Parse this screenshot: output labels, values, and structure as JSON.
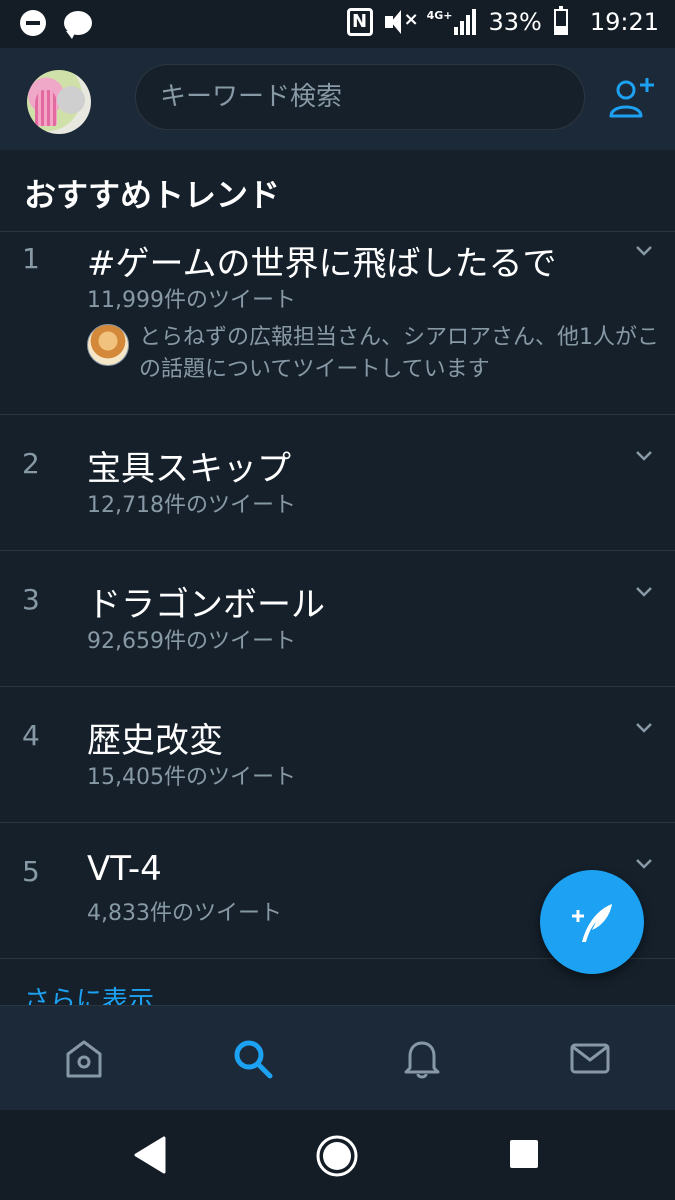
{
  "status_bar": {
    "battery": "33%",
    "time": "19:21",
    "network": "4G+",
    "icons": [
      "do-not-disturb-icon",
      "message-icon",
      "nfc-icon",
      "mute-icon",
      "signal-icon",
      "battery-icon"
    ],
    "nfc_glyph": "N"
  },
  "header": {
    "search_placeholder": "キーワード検索",
    "icons": [
      "avatar",
      "add-user-icon"
    ]
  },
  "section": {
    "title": "おすすめトレンド"
  },
  "trends": [
    {
      "rank": "1",
      "name": "#ゲームの世界に飛ばしたるで",
      "count": "11,999件のツイート",
      "context": "とらねずの広報担当さん、シアロアさん、他1人がこの話題についてツイートしています"
    },
    {
      "rank": "2",
      "name": "宝具スキップ",
      "count": "12,718件のツイート"
    },
    {
      "rank": "3",
      "name": "ドラゴンボール",
      "count": "92,659件のツイート"
    },
    {
      "rank": "4",
      "name": "歴史改変",
      "count": "15,405件のツイート"
    },
    {
      "rank": "5",
      "name": "VT-4",
      "count": "4,833件のツイート"
    }
  ],
  "show_more": "さらに表示",
  "tabs": {
    "icons": [
      "home-icon",
      "search-icon",
      "notifications-icon",
      "messages-icon"
    ],
    "active": "search-icon"
  },
  "colors": {
    "background": "#15202b",
    "header": "#1c2938",
    "accent": "#1da1f2",
    "secondary_text": "#8899a6",
    "divider": "#2c3640"
  }
}
